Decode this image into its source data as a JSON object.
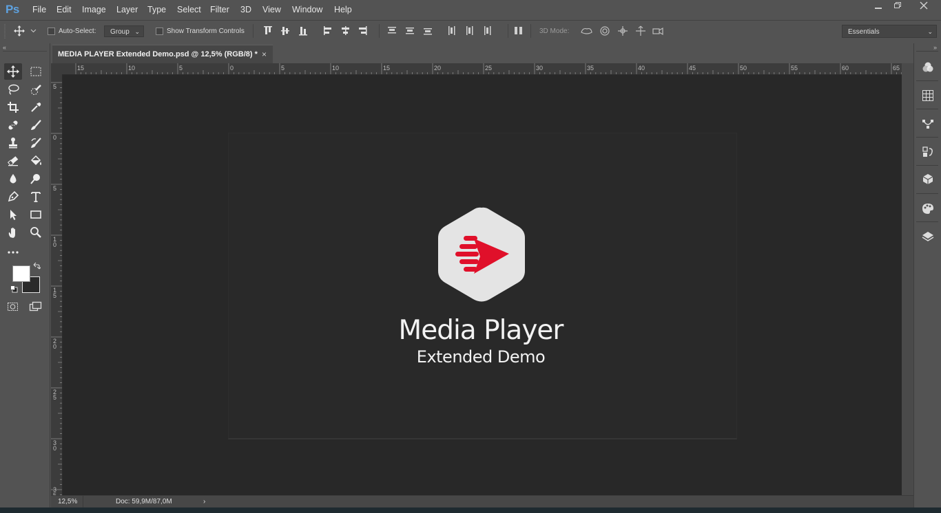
{
  "app": {
    "logo": "Ps"
  },
  "menu": [
    "File",
    "Edit",
    "Image",
    "Layer",
    "Type",
    "Select",
    "Filter",
    "3D",
    "View",
    "Window",
    "Help"
  ],
  "options": {
    "auto_select_label": "Auto-Select:",
    "auto_select_value": "Group",
    "show_transform_label": "Show Transform Controls",
    "mode_3d_label": "3D Mode:",
    "workspace": "Essentials"
  },
  "document": {
    "tab_title": "MEDIA PLAYER Extended Demo.psd @ 12,5% (RGB/8) *",
    "close_glyph": "×",
    "zoom": "12,5%",
    "doc_size": "Doc: 59,9M/87,0M"
  },
  "hruler_labels": [
    "15",
    "10",
    "5",
    "0",
    "5",
    "10",
    "15",
    "20",
    "25",
    "30",
    "35",
    "40",
    "45",
    "50",
    "55",
    "60",
    "65"
  ],
  "vruler_labels": [
    "5",
    "0",
    "5",
    "1 0",
    "1 5",
    "2 0",
    "2 5",
    "3 0",
    "3 5"
  ],
  "canvas": {
    "title": "Media Player",
    "subtitle": "Extended Demo"
  },
  "colors": {
    "accent_red": "#e0102a",
    "ps_blue": "#5ea2e0",
    "canvas_bg": "#282828"
  }
}
